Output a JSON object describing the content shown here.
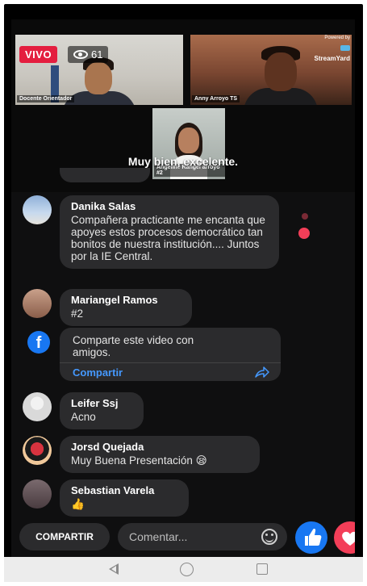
{
  "live": {
    "badge": "VIVO",
    "viewer_count": "61"
  },
  "video": {
    "tiles": [
      {
        "name": "Docente Orientador"
      },
      {
        "name": "Anny Arroyo TS"
      },
      {
        "name": "Angeline Rangel arroyo #2"
      }
    ],
    "powered_by": "Powered by",
    "brand": "StreamYard",
    "caption": "Muy bien, excelente."
  },
  "comments": [
    {
      "name": "Danika Salas",
      "text": "Compañera practicante me encanta que apoyes estos procesos democrático tan bonitos de nuestra institución.... Juntos por la IE Central."
    },
    {
      "name": "Mariangel Ramos",
      "text": "#2"
    },
    {
      "name": "Leifer Ssj",
      "text": "Acno"
    },
    {
      "name": "Jorsd Quejada",
      "text": "Muy Buena Presentación 😪"
    },
    {
      "name": "Sebastian Varela",
      "text": "👍"
    }
  ],
  "share_card": {
    "text": "Comparte este video con amigos.",
    "link": "Compartir"
  },
  "bottom_bar": {
    "share_label": "COMPARTIR",
    "comment_placeholder": "Comentar..."
  },
  "colors": {
    "live_red": "#e41e3f",
    "facebook_blue": "#1877f2",
    "love_red": "#f33e58",
    "link_blue": "#4599ff"
  },
  "icons": [
    "eye-icon",
    "streamyard-icon",
    "facebook-logo-icon",
    "share-arrow-icon",
    "emoji-icon",
    "like-icon",
    "love-icon",
    "back-icon",
    "home-icon",
    "recent-apps-icon"
  ]
}
